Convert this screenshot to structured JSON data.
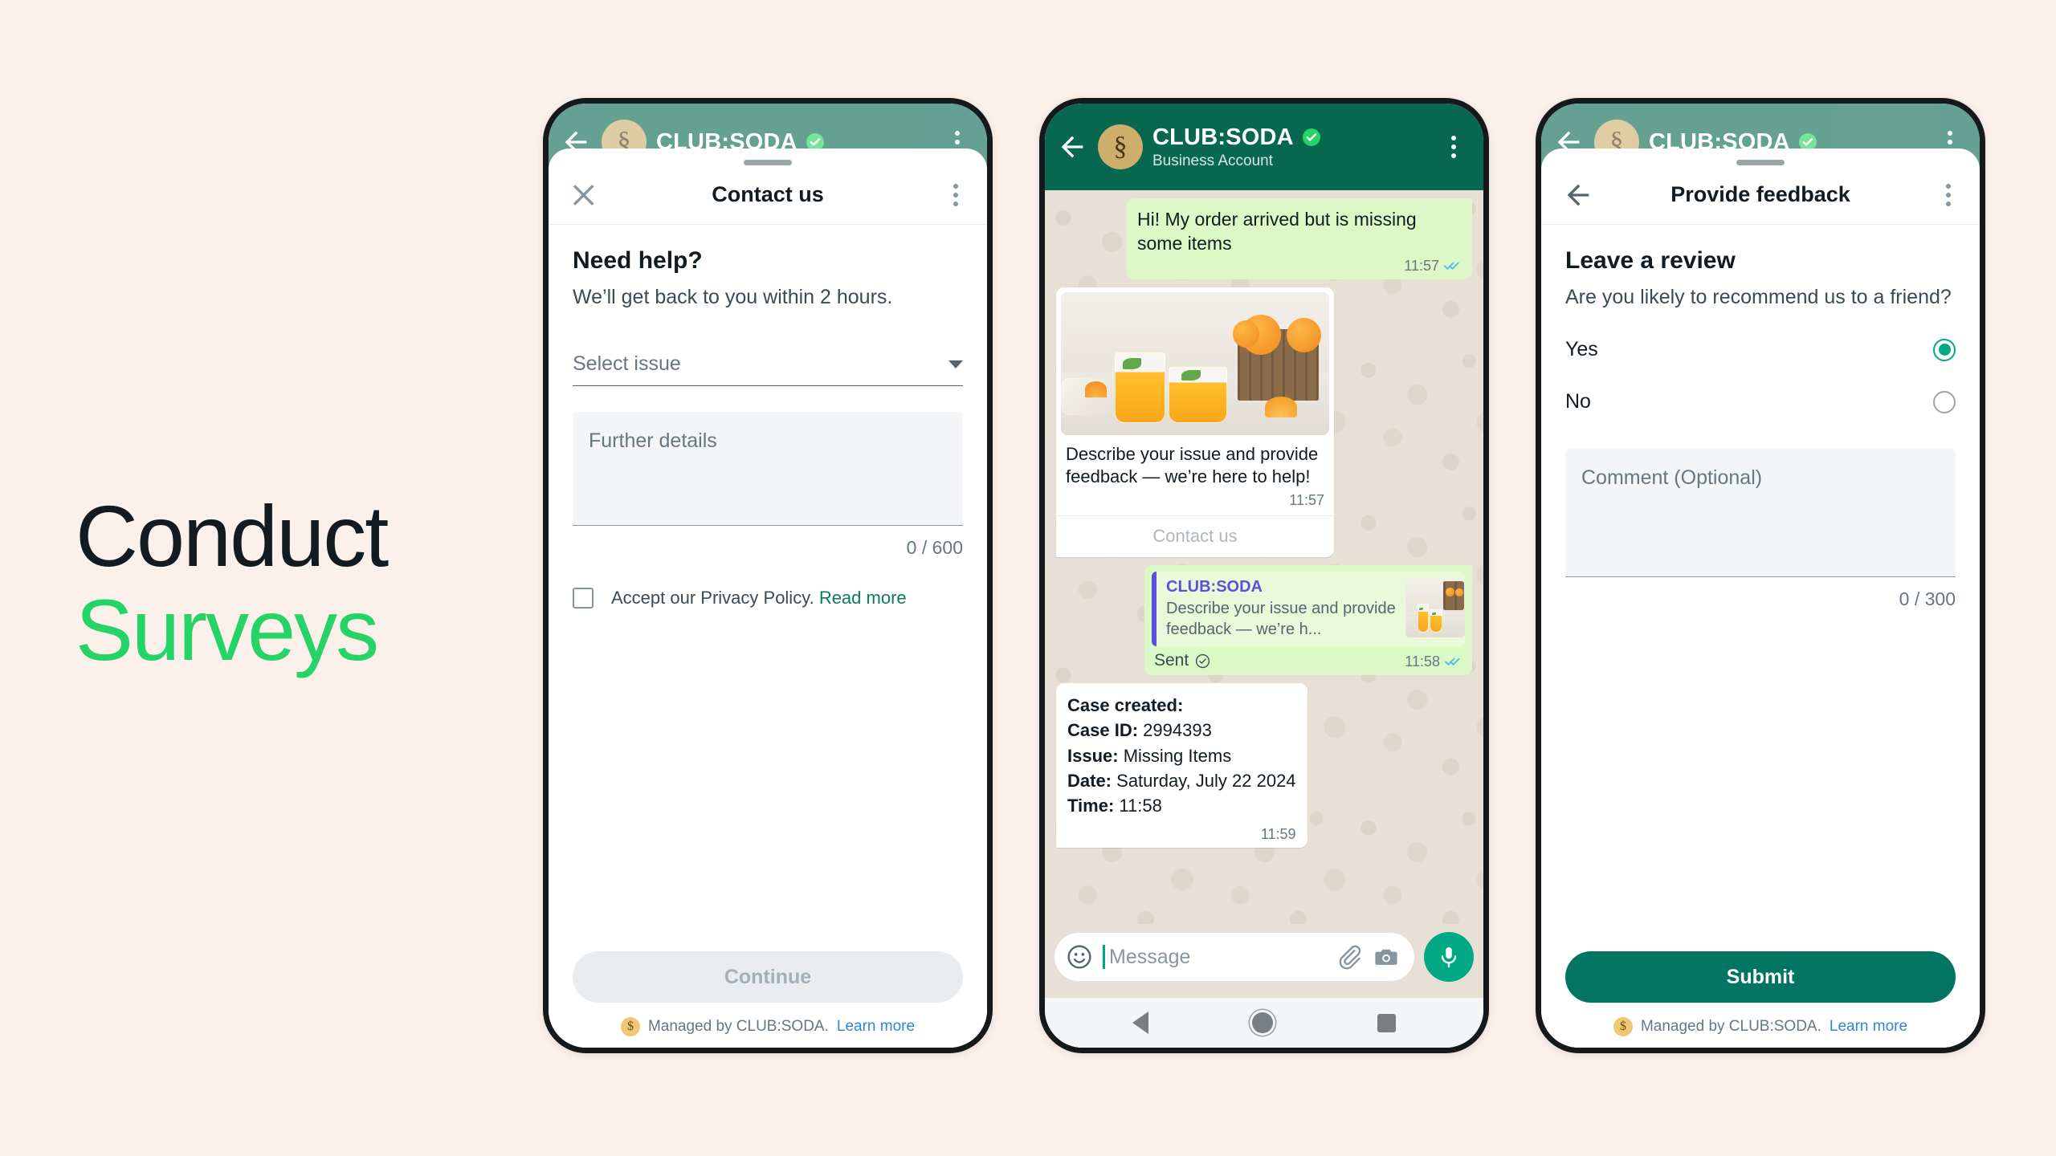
{
  "background_color": "#FCF1EA",
  "headline": {
    "line1": "Conduct",
    "line2": "Surveys",
    "line1_color": "#111B21",
    "line2_color": "#25D366"
  },
  "brand": {
    "name": "CLUB:SODA",
    "avatar_glyph": "§",
    "avatar_color": "#CDAE6B",
    "header_color": "#08684F",
    "accent_green": "#00A884",
    "primary_button_color": "#017561"
  },
  "phone1": {
    "header": {
      "title": "CLUB:SODA",
      "verified": true
    },
    "sheet": {
      "title": "Contact us",
      "close_icon": "close-icon",
      "menu_icon": "kebab-menu-icon",
      "heading": "Need help?",
      "subtext": "We’ll get back to you within 2 hours.",
      "select": {
        "placeholder": "Select issue",
        "value": ""
      },
      "details": {
        "placeholder": "Further details",
        "value": "",
        "counter": "0 / 600"
      },
      "consent": {
        "text": "Accept our Privacy Policy.",
        "link": "Read more",
        "checked": false
      },
      "submit_button": {
        "label": "Continue",
        "disabled": true
      },
      "managed": {
        "text": "Managed by CLUB:SODA.",
        "link": "Learn more"
      }
    },
    "navbar": {
      "back": "nav-back-icon",
      "home": "nav-home-icon",
      "recents": "nav-recents-icon"
    }
  },
  "phone2": {
    "header": {
      "title": "CLUB:SODA",
      "subtitle": "Business Account",
      "verified": true
    },
    "messages": [
      {
        "type": "outgoing-text",
        "text": "Hi! My order arrived but is missing some items",
        "time": "11:57",
        "status": "read"
      },
      {
        "type": "incoming-card",
        "image_alt": "orange-juice-glasses-photo",
        "text": "Describe your issue and provide feedback — we’re here to help!",
        "time": "11:57",
        "button": "Contact us"
      },
      {
        "type": "outgoing-quote",
        "quote_name": "CLUB:SODA",
        "quote_text": "Describe your issue and provide  feedback — we’re h...",
        "status_label": "Sent",
        "time": "11:58",
        "status": "read"
      },
      {
        "type": "incoming-case",
        "lines": [
          {
            "label": "Case created:",
            "value": ""
          },
          {
            "label": "Case ID:",
            "value": "2994393"
          },
          {
            "label": "Issue:",
            "value": "Missing Items"
          },
          {
            "label": "Date:",
            "value": "Saturday, July 22 2024"
          },
          {
            "label": "Time:",
            "value": "11:58"
          }
        ],
        "time": "11:59"
      }
    ],
    "composer": {
      "placeholder": "Message",
      "value": "",
      "emoji_icon": "emoji-icon",
      "attach_icon": "paperclip-icon",
      "camera_icon": "camera-icon",
      "mic_icon": "microphone-icon"
    },
    "navbar": {
      "back": "nav-back-icon",
      "home": "nav-home-icon",
      "recents": "nav-recents-icon"
    }
  },
  "phone3": {
    "header": {
      "title": "CLUB:SODA",
      "verified": true
    },
    "sheet": {
      "title": "Provide feedback",
      "back_icon": "arrow-left-icon",
      "menu_icon": "kebab-menu-icon",
      "heading": "Leave a review",
      "question": "Are you likely to recommend us to a friend?",
      "options": [
        {
          "label": "Yes",
          "selected": true
        },
        {
          "label": "No",
          "selected": false
        }
      ],
      "comment": {
        "placeholder": "Comment (Optional)",
        "value": "",
        "counter": "0 / 300"
      },
      "submit_button": {
        "label": "Submit",
        "disabled": false
      },
      "managed": {
        "text": "Managed by CLUB:SODA.",
        "link": "Learn more"
      }
    },
    "navbar": {
      "back": "nav-back-icon",
      "home": "nav-home-icon",
      "recents": "nav-recents-icon"
    }
  }
}
